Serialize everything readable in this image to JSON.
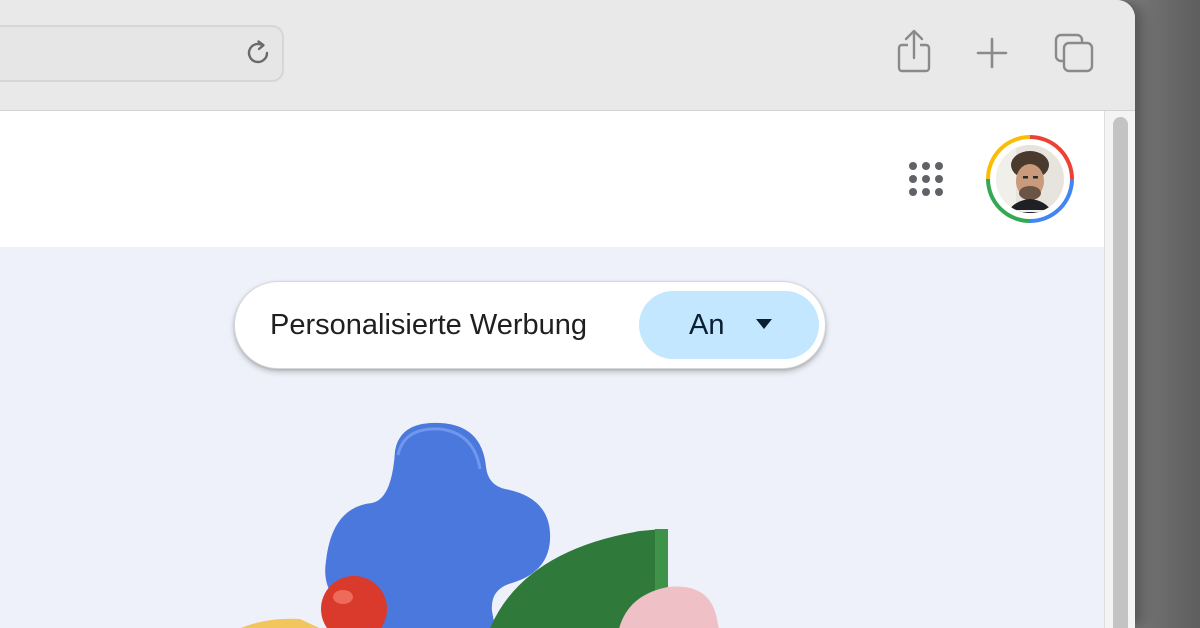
{
  "toolbar": {
    "reload_icon": "reload-icon",
    "share_icon": "share-icon",
    "new_tab_icon": "plus-icon",
    "tabs_icon": "tab-overview-icon"
  },
  "header": {
    "apps_icon": "apps-grid-icon",
    "avatar_icon": "account-avatar"
  },
  "ad_setting": {
    "label": "Personalisierte Werbung",
    "value": "An",
    "dropdown_icon": "caret-down-icon"
  },
  "colors": {
    "toggle_bg": "#c2e7ff",
    "page_bg": "#eef1f9",
    "google_blue": "#4285f4",
    "google_red": "#ea4335",
    "google_yellow": "#fbbc04",
    "google_green": "#34a853"
  }
}
